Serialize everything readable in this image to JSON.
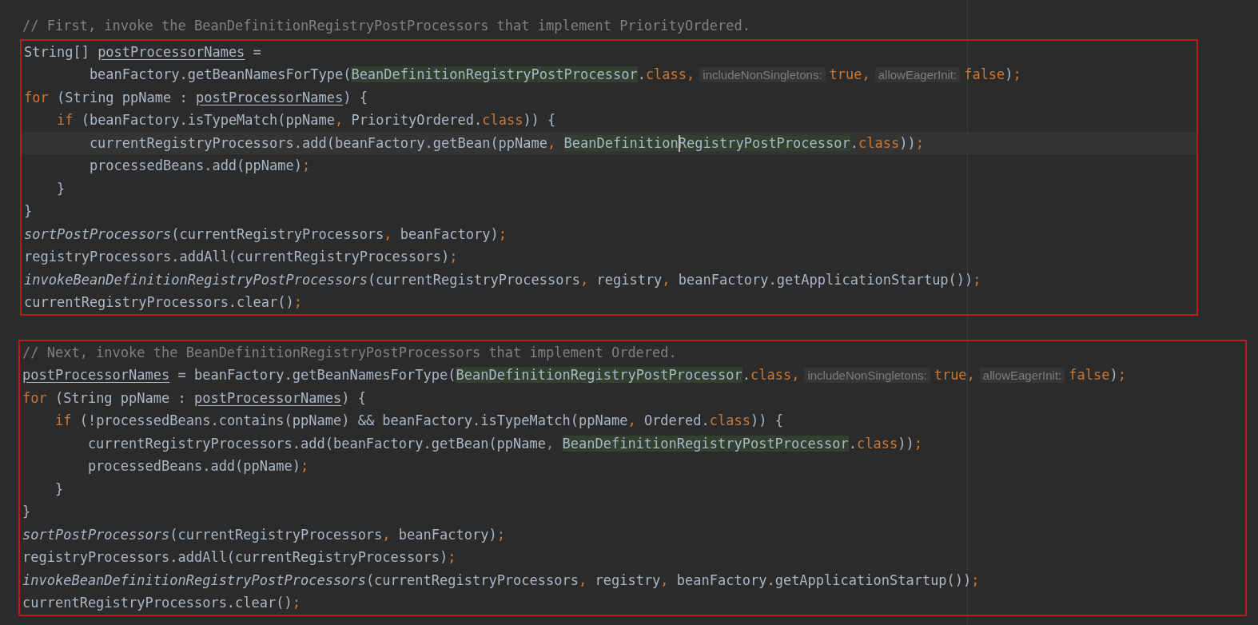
{
  "editor": {
    "blocks": [
      {
        "boxed": false,
        "lines": [
          {
            "tokens": [
              {
                "kind": "comment",
                "text": "// First, invoke the BeanDefinitionRegistryPostProcessors that implement PriorityOrdered."
              }
            ]
          }
        ]
      },
      {
        "boxed": true,
        "lines": [
          {
            "tokens": [
              {
                "kind": "plain",
                "text": "String[] "
              },
              {
                "kind": "underlined",
                "text": "postProcessorNames"
              },
              {
                "kind": "plain",
                "text": " ="
              }
            ],
            "children": [
              {
                "continuation": true,
                "tokens": [
                  {
                    "kind": "plain",
                    "text": "beanFactory.getBeanNamesForType("
                  },
                  {
                    "kind": "match",
                    "text": "BeanDefinitionRegistryPostProcessor"
                  },
                  {
                    "kind": "plain",
                    "text": "."
                  },
                  {
                    "kind": "keyword",
                    "text": "class,"
                  },
                  {
                    "kind": "hint",
                    "text": "includeNonSingletons:"
                  },
                  {
                    "kind": "keyword",
                    "text": "true,"
                  },
                  {
                    "kind": "hint",
                    "text": "allowEagerInit:"
                  },
                  {
                    "kind": "keyword",
                    "text": "false"
                  },
                  {
                    "kind": "plain",
                    "text": ")"
                  },
                  {
                    "kind": "keyword",
                    "text": ";"
                  }
                ]
              }
            ]
          },
          {
            "tokens": [
              {
                "kind": "keyword",
                "text": "for"
              },
              {
                "kind": "plain",
                "text": " (String ppName : "
              },
              {
                "kind": "underlined",
                "text": "postProcessorNames"
              },
              {
                "kind": "plain",
                "text": ") {"
              }
            ],
            "children": [
              {
                "tokens": [
                  {
                    "kind": "keyword",
                    "text": "if"
                  },
                  {
                    "kind": "plain",
                    "text": " (beanFactory.isTypeMatch(ppName"
                  },
                  {
                    "kind": "keyword",
                    "text": ","
                  },
                  {
                    "kind": "plain",
                    "text": " PriorityOrdered."
                  },
                  {
                    "kind": "keyword",
                    "text": "class"
                  },
                  {
                    "kind": "plain",
                    "text": ")) {"
                  }
                ],
                "children": [
                  {
                    "current": true,
                    "tokens": [
                      {
                        "kind": "plain",
                        "text": "currentRegistryProcessors.add(beanFactory.getBean(ppName"
                      },
                      {
                        "kind": "keyword",
                        "text": ", "
                      },
                      {
                        "kind": "match",
                        "text": "BeanDefinitionRegistryPostProcessor"
                      },
                      {
                        "kind": "plain",
                        "text": "."
                      },
                      {
                        "kind": "keyword",
                        "text": "class"
                      },
                      {
                        "kind": "plain",
                        "text": "))"
                      },
                      {
                        "kind": "keyword",
                        "text": ";"
                      }
                    ]
                  },
                  {
                    "tokens": [
                      {
                        "kind": "plain",
                        "text": "processedBeans.add(ppName)"
                      },
                      {
                        "kind": "keyword",
                        "text": ";"
                      }
                    ]
                  }
                ]
              },
              {
                "tokens": [
                  {
                    "kind": "plain",
                    "text": "}"
                  }
                ]
              }
            ]
          },
          {
            "tokens": [
              {
                "kind": "plain",
                "text": "}"
              }
            ]
          },
          {
            "tokens": [
              {
                "kind": "static",
                "text": "sortPostProcessors"
              },
              {
                "kind": "plain",
                "text": "(currentRegistryProcessors"
              },
              {
                "kind": "keyword",
                "text": ","
              },
              {
                "kind": "plain",
                "text": " beanFactory)"
              },
              {
                "kind": "keyword",
                "text": ";"
              }
            ]
          },
          {
            "tokens": [
              {
                "kind": "plain",
                "text": "registryProcessors.addAll(currentRegistryProcessors)"
              },
              {
                "kind": "keyword",
                "text": ";"
              }
            ]
          },
          {
            "tokens": [
              {
                "kind": "static",
                "text": "invokeBeanDefinitionRegistryPostProcessors"
              },
              {
                "kind": "plain",
                "text": "(currentRegistryProcessors"
              },
              {
                "kind": "keyword",
                "text": ","
              },
              {
                "kind": "plain",
                "text": " registry"
              },
              {
                "kind": "keyword",
                "text": ","
              },
              {
                "kind": "plain",
                "text": " beanFactory.getApplicationStartup())"
              },
              {
                "kind": "keyword",
                "text": ";"
              }
            ]
          },
          {
            "tokens": [
              {
                "kind": "plain",
                "text": "currentRegistryProcessors.clear()"
              },
              {
                "kind": "keyword",
                "text": ";"
              }
            ]
          }
        ]
      },
      {
        "boxed": true,
        "lines": [
          {
            "tokens": [
              {
                "kind": "comment",
                "text": "// Next, invoke the BeanDefinitionRegistryPostProcessors that implement Ordered."
              }
            ]
          },
          {
            "tokens": [
              {
                "kind": "underlined",
                "text": "postProcessorNames"
              },
              {
                "kind": "plain",
                "text": " = beanFactory.getBeanNamesForType("
              },
              {
                "kind": "match",
                "text": "BeanDefinitionRegistryPostProcessor"
              },
              {
                "kind": "plain",
                "text": "."
              },
              {
                "kind": "keyword",
                "text": "class,"
              },
              {
                "kind": "hint",
                "text": "includeNonSingletons:"
              },
              {
                "kind": "keyword",
                "text": "true,"
              },
              {
                "kind": "hint",
                "text": "allowEagerInit:"
              },
              {
                "kind": "keyword",
                "text": "false"
              },
              {
                "kind": "plain",
                "text": ")"
              },
              {
                "kind": "keyword",
                "text": ";"
              }
            ]
          },
          {
            "tokens": [
              {
                "kind": "keyword",
                "text": "for"
              },
              {
                "kind": "plain",
                "text": " (String ppName : "
              },
              {
                "kind": "underlined",
                "text": "postProcessorNames"
              },
              {
                "kind": "plain",
                "text": ") {"
              }
            ],
            "children": [
              {
                "tokens": [
                  {
                    "kind": "keyword",
                    "text": "if"
                  },
                  {
                    "kind": "plain",
                    "text": " (!processedBeans.contains(ppName) && beanFactory.isTypeMatch(ppName"
                  },
                  {
                    "kind": "keyword",
                    "text": ","
                  },
                  {
                    "kind": "plain",
                    "text": " Ordered."
                  },
                  {
                    "kind": "keyword",
                    "text": "class"
                  },
                  {
                    "kind": "plain",
                    "text": ")) {"
                  }
                ],
                "children": [
                  {
                    "tokens": [
                      {
                        "kind": "plain",
                        "text": "currentRegistryProcessors.add(beanFactory.getBean(ppName"
                      },
                      {
                        "kind": "keyword",
                        "text": ", "
                      },
                      {
                        "kind": "match",
                        "text": "BeanDefinitionRegistryPostProcessor"
                      },
                      {
                        "kind": "plain",
                        "text": "."
                      },
                      {
                        "kind": "keyword",
                        "text": "class"
                      },
                      {
                        "kind": "plain",
                        "text": "))"
                      },
                      {
                        "kind": "keyword",
                        "text": ";"
                      }
                    ]
                  },
                  {
                    "tokens": [
                      {
                        "kind": "plain",
                        "text": "processedBeans.add(ppName)"
                      },
                      {
                        "kind": "keyword",
                        "text": ";"
                      }
                    ]
                  }
                ]
              },
              {
                "tokens": [
                  {
                    "kind": "plain",
                    "text": "}"
                  }
                ]
              }
            ]
          },
          {
            "tokens": [
              {
                "kind": "plain",
                "text": "}"
              }
            ]
          },
          {
            "tokens": [
              {
                "kind": "static",
                "text": "sortPostProcessors"
              },
              {
                "kind": "plain",
                "text": "(currentRegistryProcessors"
              },
              {
                "kind": "keyword",
                "text": ","
              },
              {
                "kind": "plain",
                "text": " beanFactory)"
              },
              {
                "kind": "keyword",
                "text": ";"
              }
            ]
          },
          {
            "tokens": [
              {
                "kind": "plain",
                "text": "registryProcessors.addAll(currentRegistryProcessors)"
              },
              {
                "kind": "keyword",
                "text": ";"
              }
            ]
          },
          {
            "tokens": [
              {
                "kind": "static",
                "text": "invokeBeanDefinitionRegistryPostProcessors"
              },
              {
                "kind": "plain",
                "text": "(currentRegistryProcessors"
              },
              {
                "kind": "keyword",
                "text": ","
              },
              {
                "kind": "plain",
                "text": " registry"
              },
              {
                "kind": "keyword",
                "text": ","
              },
              {
                "kind": "plain",
                "text": " beanFactory.getApplicationStartup())"
              },
              {
                "kind": "keyword",
                "text": ";"
              }
            ]
          },
          {
            "tokens": [
              {
                "kind": "plain",
                "text": "currentRegistryProcessors.clear()"
              },
              {
                "kind": "keyword",
                "text": ";"
              }
            ]
          }
        ]
      }
    ]
  }
}
